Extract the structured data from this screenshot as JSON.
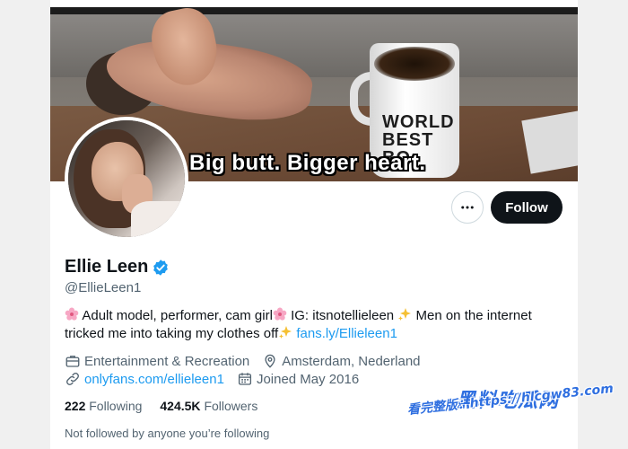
{
  "banner": {
    "caption": "Big butt. Bigger heart.",
    "mug_text": "WORLD BEST BO"
  },
  "actions": {
    "more_icon": "ellipsis-icon",
    "follow_label": "Follow"
  },
  "profile": {
    "display_name": "Ellie Leen",
    "handle": "@EllieLeen1",
    "verified": true
  },
  "bio": {
    "part1": "Adult model, performer, cam girl",
    "part2": " IG: itsnotellieleen ",
    "part3": " Men on the internet tricked me into taking my clothes off",
    "link": "fans.ly/Ellieleen1"
  },
  "meta": {
    "category": "Entertainment & Recreation",
    "location": "Amsterdam, Nederland",
    "website": "onlyfans.com/ellieleen1",
    "joined": "Joined May 2016"
  },
  "stats": {
    "following_count": "222",
    "following_label": "Following",
    "followers_count": "424.5K",
    "followers_label": "Followers"
  },
  "followed_by": "Not followed by anyone you’re following",
  "watermark": {
    "title": "黑料吃瓜网",
    "url": "看完整版：https://hlcgw83.com"
  },
  "colors": {
    "accent": "#1d9bf0",
    "text": "#0f1419",
    "secondary": "#536471",
    "follow_bg": "#0f1419"
  }
}
